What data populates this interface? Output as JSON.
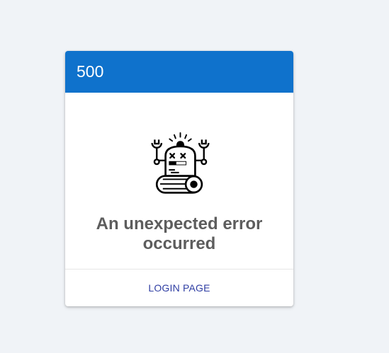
{
  "card": {
    "header_code": "500",
    "message": "An unexpected error occurred",
    "illustration_icon": "broken-robot-icon",
    "footer_link": "LOGIN PAGE"
  },
  "colors": {
    "page_background": "#f0f3f7",
    "header_background": "#0f72cc",
    "header_text": "#ffffff",
    "message_text": "#5d5d5d",
    "link_text": "#2f3ea3"
  }
}
